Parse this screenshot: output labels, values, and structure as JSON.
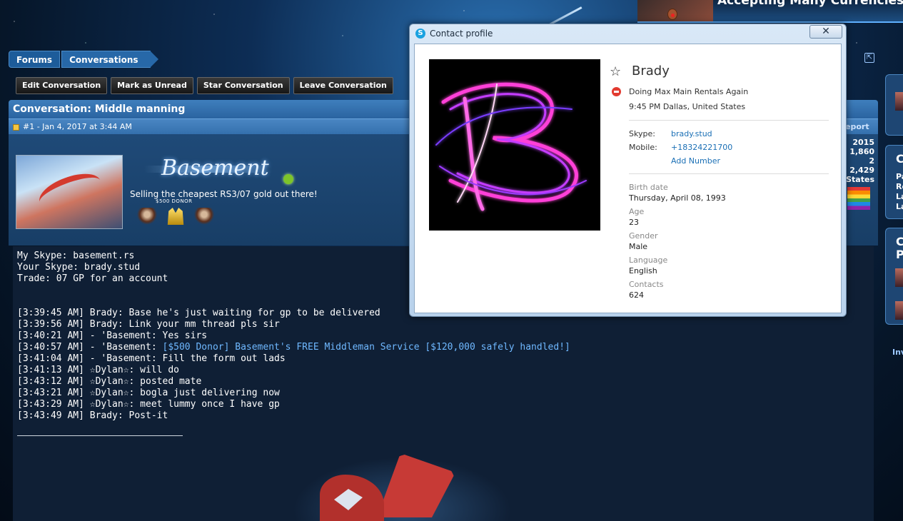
{
  "banner": {
    "text": "Accepting Many Currencies! [$"
  },
  "breadcrumb": {
    "items": [
      "Forums",
      "Conversations"
    ]
  },
  "actions": [
    "Edit Conversation",
    "Mark as Unread",
    "Star Conversation",
    "Leave Conversation"
  ],
  "conversation": {
    "title": "Conversation: Middle manning",
    "post_meta": "#1 - Jan 4, 2017 at 3:44 AM",
    "report": "eport"
  },
  "user": {
    "name": "Basement",
    "title": "Selling the cheapest RS3/07 gold out there!",
    "donor_label": "$500 DONOR"
  },
  "stats": [
    "2015",
    "1,860",
    "2",
    "2,429",
    "States"
  ],
  "message": {
    "intro": [
      "My Skype: basement.rs",
      "Your Skype: brady.stud",
      "Trade: 07 GP for an account"
    ],
    "log": [
      {
        "text": "[3:39:45 AM] Brady: Base he's just waiting for gp to be delivered",
        "link": ""
      },
      {
        "text": "[3:39:56 AM] Brady: Link your mm thread pls sir",
        "link": ""
      },
      {
        "text": "[3:40:21 AM] - 'Basement: Yes sirs",
        "link": ""
      },
      {
        "text": "[3:40:57 AM] - 'Basement: ",
        "link": "[$500 Donor] Basement's FREE Middleman Service [$120,000 safely handled!]"
      },
      {
        "text": "[3:41:04 AM] - 'Basement: Fill the form out lads",
        "link": ""
      },
      {
        "text": "[3:41:13 AM] ☆Dylan☆: will do",
        "link": ""
      },
      {
        "text": "[3:43:12 AM] ☆Dylan☆: posted mate",
        "link": ""
      },
      {
        "text": "[3:43:21 AM] ☆Dylan☆: bogla just delivering now",
        "link": ""
      },
      {
        "text": "[3:43:29 AM] ☆Dylan☆: meet lummy once I have gp",
        "link": ""
      },
      {
        "text": "[3:43:49 AM] Brady: Post-it",
        "link": ""
      }
    ]
  },
  "sidebar": {
    "box1": "",
    "box2": [
      "C",
      "Pa",
      "Re",
      "La",
      "La"
    ],
    "box3": [
      "C",
      "P"
    ],
    "footer": "Inv"
  },
  "dialog": {
    "title": "Contact profile",
    "close": "✕",
    "name": "Brady",
    "status": "Doing Max Main Rentals Again",
    "local_time": "9:45 PM Dallas, United States",
    "skype_label": "Skype:",
    "skype_value": "brady.stud",
    "mobile_label": "Mobile:",
    "mobile_value": "+18324221700",
    "add_number": "Add Number",
    "fields": [
      {
        "label": "Birth date",
        "value": "Thursday, April 08, 1993"
      },
      {
        "label": "Age",
        "value": "23"
      },
      {
        "label": "Gender",
        "value": "Male"
      },
      {
        "label": "Language",
        "value": "English"
      },
      {
        "label": "Contacts",
        "value": "624"
      }
    ]
  },
  "colors": {
    "link": "#6fb8ff",
    "skype_blue": "#1aa2e0",
    "status_busy": "#e23b30",
    "online": "#7dc42a"
  }
}
